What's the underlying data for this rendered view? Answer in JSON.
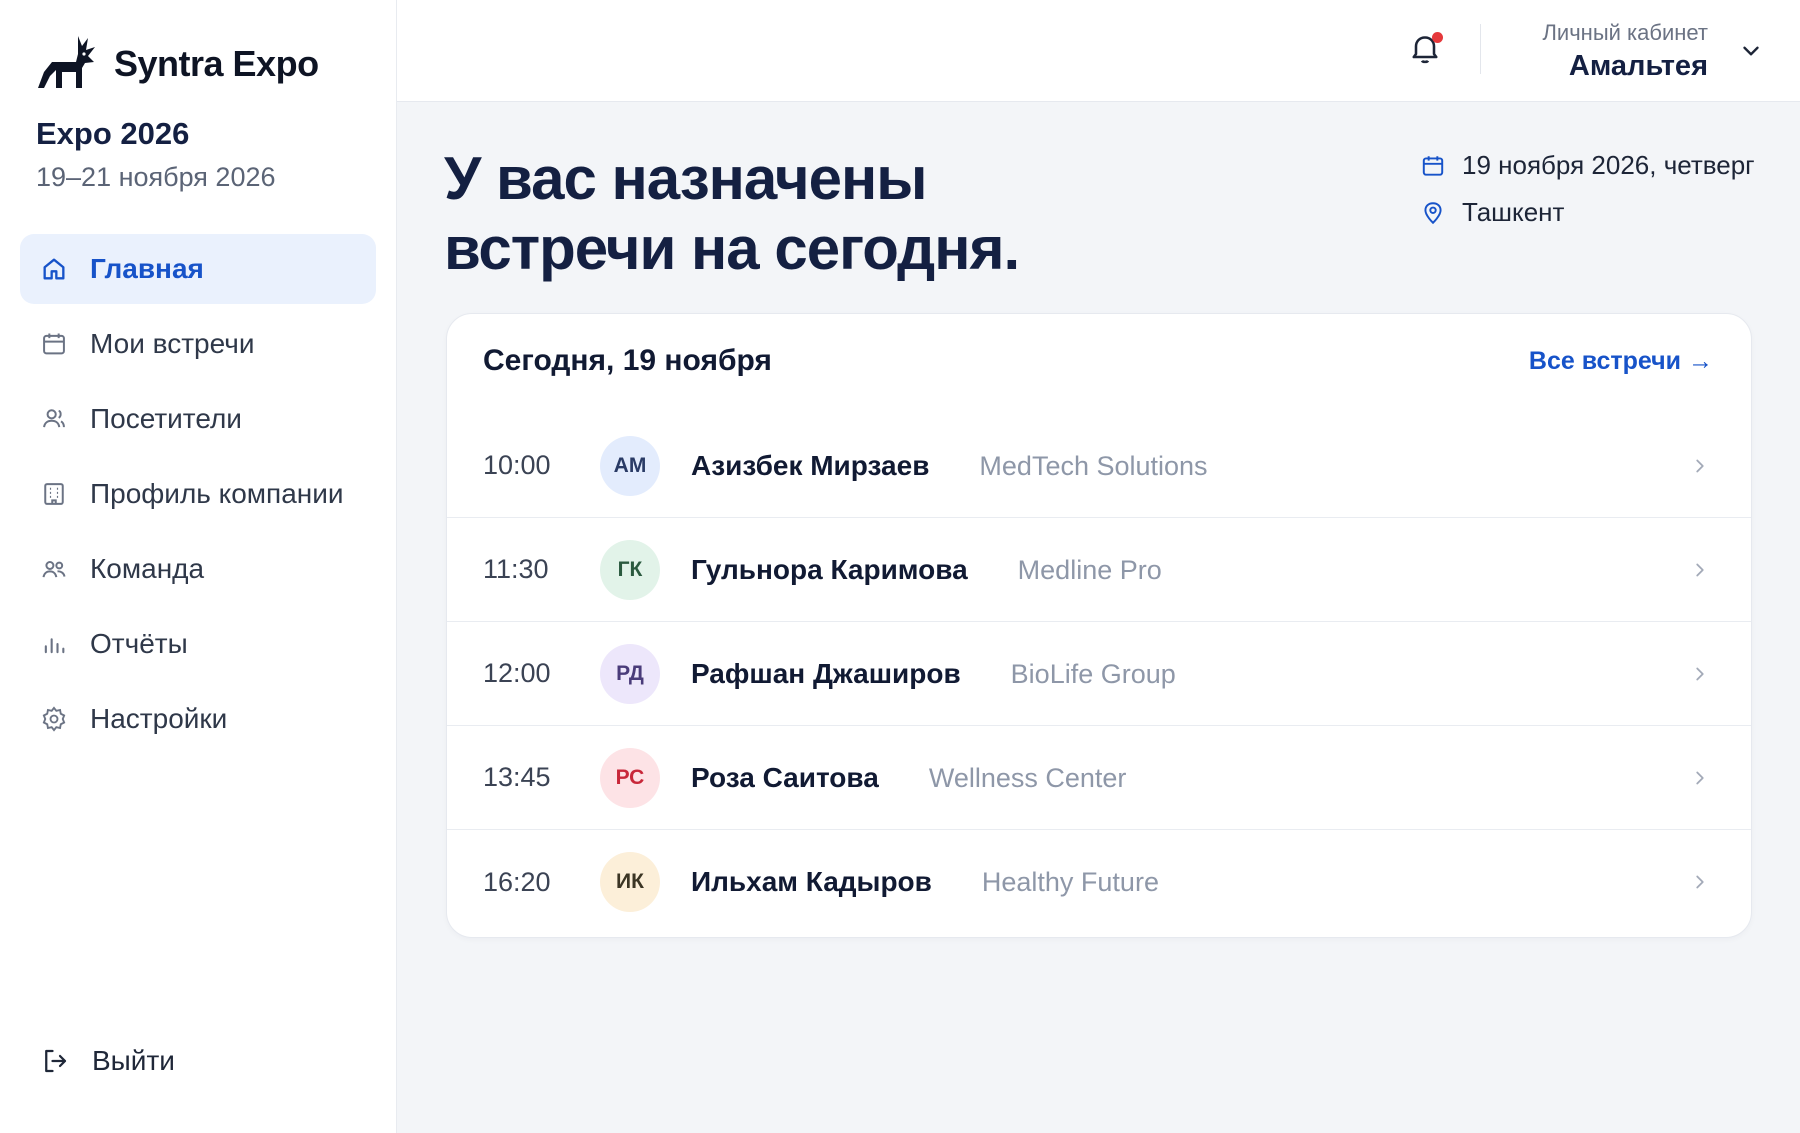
{
  "brand": {
    "name": "Syntra Expo"
  },
  "event": {
    "title": "Expo 2026",
    "dates": "19–21 ноября 2026"
  },
  "sidebar": {
    "items": [
      {
        "label": "Главная",
        "icon": "home-icon",
        "active": true
      },
      {
        "label": "Мои встречи",
        "icon": "calendar-icon",
        "active": false
      },
      {
        "label": "Посетители",
        "icon": "users-icon",
        "active": false
      },
      {
        "label": "Профиль компании",
        "icon": "building-icon",
        "active": false
      },
      {
        "label": "Команда",
        "icon": "team-icon",
        "active": false
      },
      {
        "label": "Отчёты",
        "icon": "chart-icon",
        "active": false
      },
      {
        "label": "Настройки",
        "icon": "gear-icon",
        "active": false
      }
    ],
    "logout_label": "Выйти"
  },
  "header": {
    "account_label": "Личный кабинет",
    "account_name": "Амальтея",
    "has_notifications": true
  },
  "main": {
    "headline_line1": "У вас назначены",
    "headline_line2": "встречи на сегодня.",
    "date": "19 ноября 2026, четверг",
    "city": "Ташкент"
  },
  "meetings": {
    "title": "Сегодня, 19 ноября",
    "all_link": "Все встречи →",
    "rows": [
      {
        "time": "10:00",
        "initials": "АМ",
        "name": "Азизбек Мирзаев",
        "company": "MedTech Solutions",
        "avatar_bg": "#e3ecfd",
        "avatar_fg": "#2a3b66"
      },
      {
        "time": "11:30",
        "initials": "ГК",
        "name": "Гульнора Каримова",
        "company": "Medline Pro",
        "avatar_bg": "#e2f3e9",
        "avatar_fg": "#2b5a3f"
      },
      {
        "time": "12:00",
        "initials": "РД",
        "name": "Рафшан Джаширов",
        "company": "BioLife Group",
        "avatar_bg": "#ede7fb",
        "avatar_fg": "#4a3c7a"
      },
      {
        "time": "13:45",
        "initials": "РС",
        "name": "Роза Саитова",
        "company": "Wellness Center",
        "avatar_bg": "#fde3e6",
        "avatar_fg": "#c8283a"
      },
      {
        "time": "16:20",
        "initials": "ИК",
        "name": "Ильхам Кадыров",
        "company": "Healthy Future",
        "avatar_bg": "#fcefd9",
        "avatar_fg": "#3b3524"
      }
    ]
  },
  "colors": {
    "accent": "#1753c9",
    "heading": "#142042",
    "notification_dot": "#e5383b"
  }
}
